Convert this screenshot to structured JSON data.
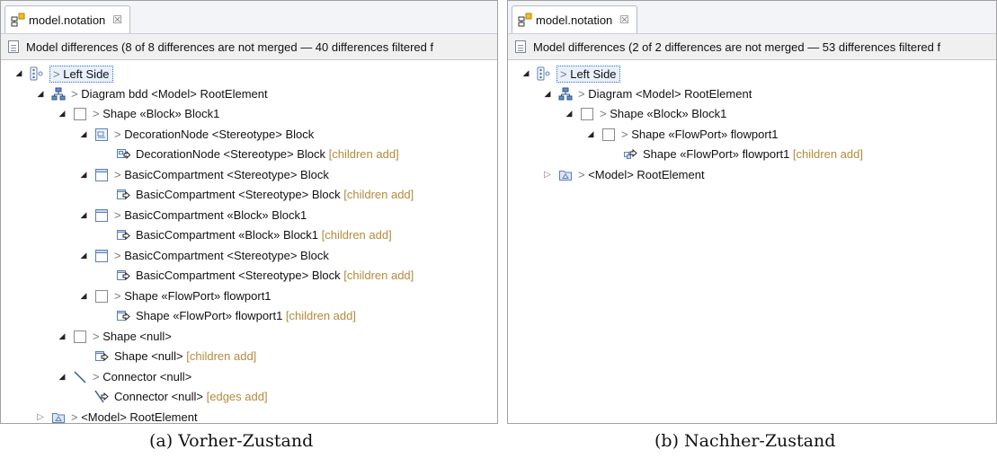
{
  "panels": [
    {
      "tab_label": "model.notation",
      "tab_close": "☒",
      "info": "Model differences  (8 of 8 differences are not merged — 40 differences filtered f",
      "rows": [
        {
          "level": 0,
          "twisty": "▲",
          "icon": "side",
          "prefix": "> ",
          "text": "Left Side",
          "suffix": "",
          "selected": true
        },
        {
          "level": 1,
          "twisty": "▲",
          "icon": "diagram",
          "prefix": "> ",
          "text": "Diagram bdd <Model> RootElement",
          "suffix": ""
        },
        {
          "level": 2,
          "twisty": "▲",
          "icon": "shape",
          "prefix": "> ",
          "text": "Shape «Block» Block1",
          "suffix": ""
        },
        {
          "level": 3,
          "twisty": "▲",
          "icon": "deco",
          "prefix": "> ",
          "text": "DecorationNode <Stereotype> Block",
          "suffix": ""
        },
        {
          "level": 4,
          "twisty": "",
          "icon": "decoadd",
          "prefix": "",
          "text": "DecorationNode <Stereotype> Block",
          "suffix": " [children add]"
        },
        {
          "level": 3,
          "twisty": "▲",
          "icon": "compart",
          "prefix": "> ",
          "text": "BasicCompartment <Stereotype> Block",
          "suffix": ""
        },
        {
          "level": 4,
          "twisty": "",
          "icon": "add",
          "prefix": "",
          "text": "BasicCompartment <Stereotype> Block",
          "suffix": " [children add]"
        },
        {
          "level": 3,
          "twisty": "▲",
          "icon": "compart",
          "prefix": "> ",
          "text": "BasicCompartment «Block» Block1",
          "suffix": ""
        },
        {
          "level": 4,
          "twisty": "",
          "icon": "add",
          "prefix": "",
          "text": "BasicCompartment «Block» Block1",
          "suffix": " [children add]"
        },
        {
          "level": 3,
          "twisty": "▲",
          "icon": "compart",
          "prefix": "> ",
          "text": "BasicCompartment <Stereotype> Block",
          "suffix": ""
        },
        {
          "level": 4,
          "twisty": "",
          "icon": "add",
          "prefix": "",
          "text": "BasicCompartment <Stereotype> Block",
          "suffix": " [children add]"
        },
        {
          "level": 3,
          "twisty": "▲",
          "icon": "shape",
          "prefix": "> ",
          "text": "Shape «FlowPort» flowport1",
          "suffix": ""
        },
        {
          "level": 4,
          "twisty": "",
          "icon": "add",
          "prefix": "",
          "text": "Shape «FlowPort» flowport1",
          "suffix": " [children add]"
        },
        {
          "level": 2,
          "twisty": "▲",
          "icon": "shape",
          "prefix": "> ",
          "text": "Shape <null>",
          "suffix": ""
        },
        {
          "level": 3,
          "twisty": "",
          "icon": "add",
          "prefix": "",
          "text": "Shape <null>",
          "suffix": " [children add]"
        },
        {
          "level": 2,
          "twisty": "▲",
          "icon": "connector",
          "prefix": "> ",
          "text": "Connector <null>",
          "suffix": ""
        },
        {
          "level": 3,
          "twisty": "",
          "icon": "connadd",
          "prefix": "",
          "text": "Connector <null>",
          "suffix": " [edges add]"
        },
        {
          "level": 1,
          "twisty": "▷",
          "icon": "model",
          "prefix": "> ",
          "text": "<Model> RootElement",
          "suffix": ""
        }
      ]
    },
    {
      "tab_label": "model.notation",
      "tab_close": "☒",
      "info": "Model differences  (2 of 2 differences are not merged — 53 differences filtered f",
      "rows": [
        {
          "level": 0,
          "twisty": "▲",
          "icon": "side",
          "prefix": "> ",
          "text": "Left Side",
          "suffix": "",
          "selected": true
        },
        {
          "level": 1,
          "twisty": "▲",
          "icon": "diagram",
          "prefix": "> ",
          "text": "Diagram <Model> RootElement",
          "suffix": ""
        },
        {
          "level": 2,
          "twisty": "▲",
          "icon": "shape",
          "prefix": "> ",
          "text": "Shape «Block» Block1",
          "suffix": ""
        },
        {
          "level": 3,
          "twisty": "▲",
          "icon": "shape",
          "prefix": "> ",
          "text": "Shape «FlowPort» flowport1",
          "suffix": ""
        },
        {
          "level": 4,
          "twisty": "",
          "icon": "portadd",
          "prefix": "",
          "text": "Shape «FlowPort» flowport1",
          "suffix": " [children add]"
        },
        {
          "level": 1,
          "twisty": "▷",
          "icon": "model",
          "prefix": "> ",
          "text": "<Model> RootElement",
          "suffix": ""
        }
      ]
    }
  ],
  "captions": [
    "(a) Vorher-Zustand",
    "(b) Nachher-Zustand"
  ]
}
